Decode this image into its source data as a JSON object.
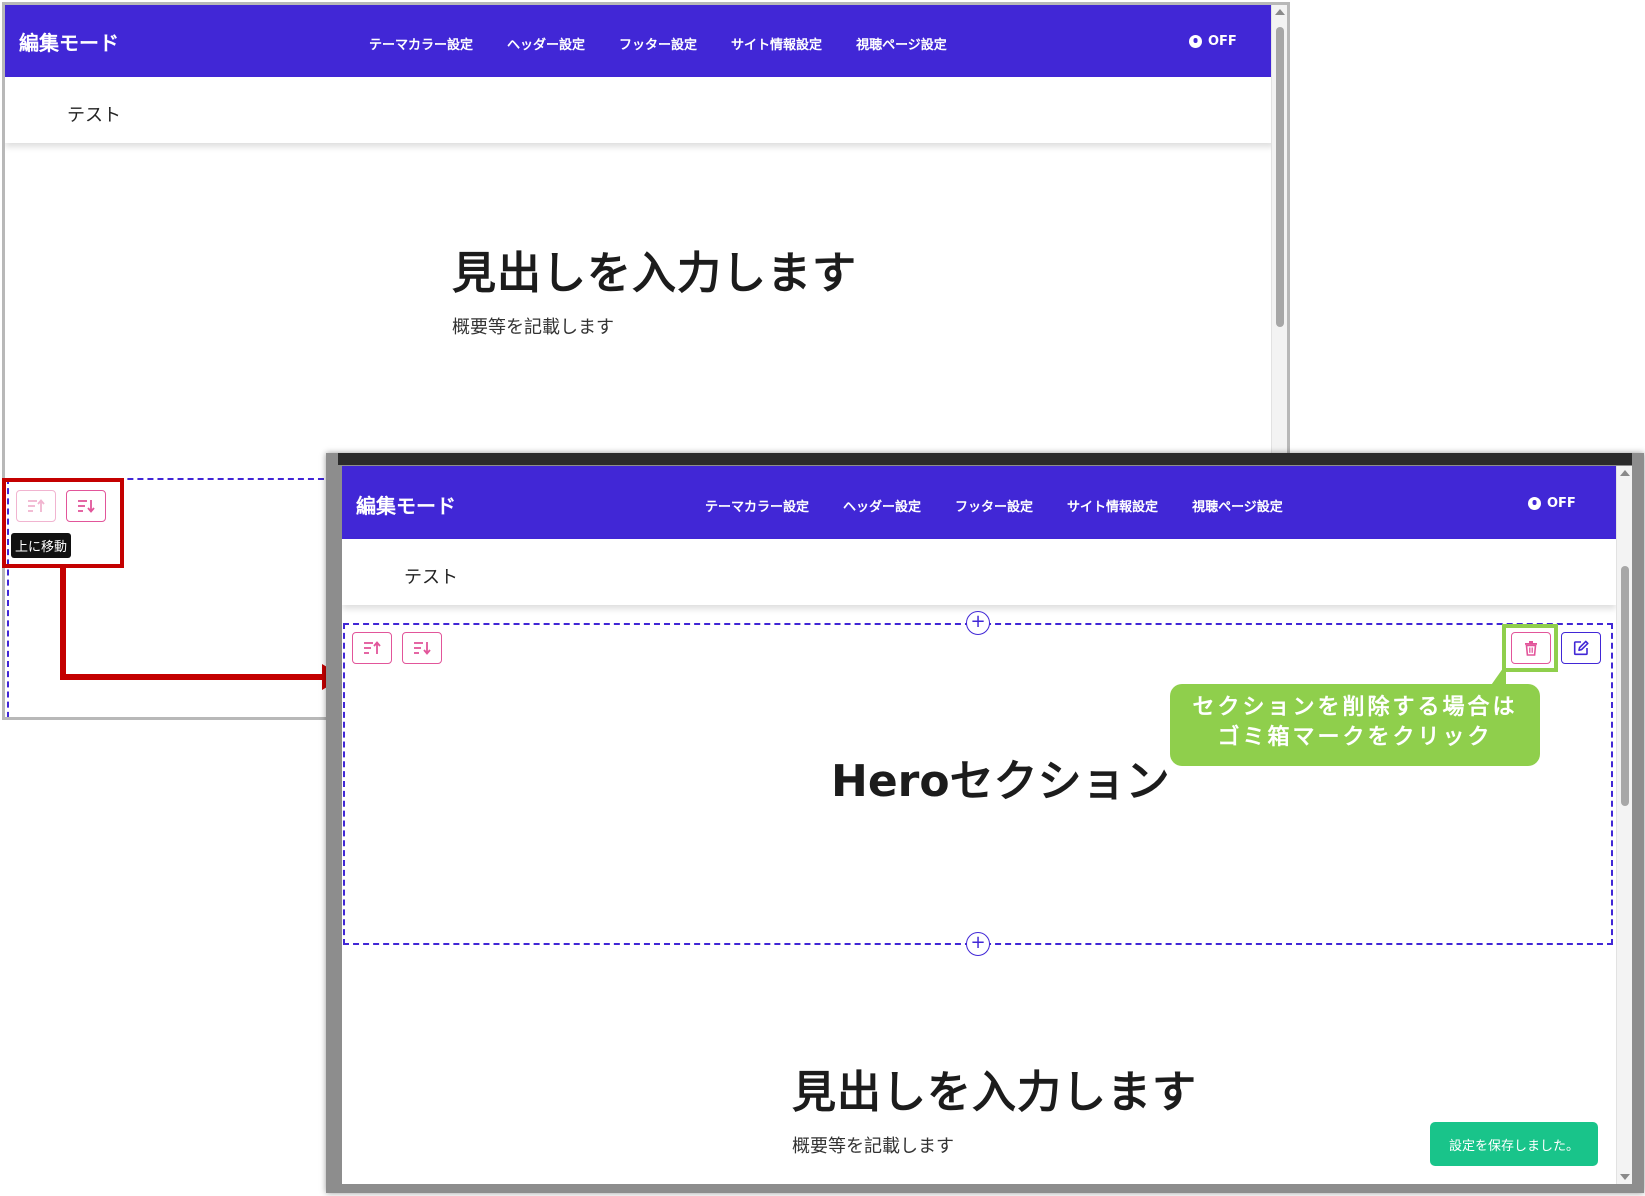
{
  "window_back": {
    "navbar": {
      "brand": "編集モード",
      "menu": [
        "テーマカラー設定",
        "ヘッダー設定",
        "フッター設定",
        "サイト情報設定",
        "視聴ページ設定"
      ],
      "toggle_label": "OFF"
    },
    "subheader": {
      "site_name": "テスト"
    },
    "content": {
      "heading": "見出しを入力します",
      "description": "概要等を記載します"
    },
    "tooltip": "上に移動"
  },
  "window_front": {
    "navbar": {
      "brand": "編集モード",
      "menu": [
        "テーマカラー設定",
        "ヘッダー設定",
        "フッター設定",
        "サイト情報設定",
        "視聴ページ設定"
      ],
      "toggle_label": "OFF"
    },
    "subheader": {
      "site_name": "テスト"
    },
    "hero": {
      "title": "Heroセクション"
    },
    "plus_label": "+",
    "callout": {
      "line1": "セクションを削除する場合は",
      "line2": "ゴミ箱マークをクリック"
    },
    "content": {
      "heading": "見出しを入力します",
      "description": "概要等を記載します"
    },
    "toast": "設定を保存しました。"
  },
  "colors": {
    "navbar": "#4127d6",
    "action_pink": "#e2559a",
    "annotation_red": "#c40000",
    "callout_green": "#8fcf4c",
    "toast_green": "#19c48a"
  },
  "icons": {
    "move_up": "move-up-icon",
    "move_down": "move-down-icon",
    "delete": "trash-icon",
    "edit": "edit-icon",
    "user": "user-circle-icon",
    "add": "plus-icon"
  }
}
